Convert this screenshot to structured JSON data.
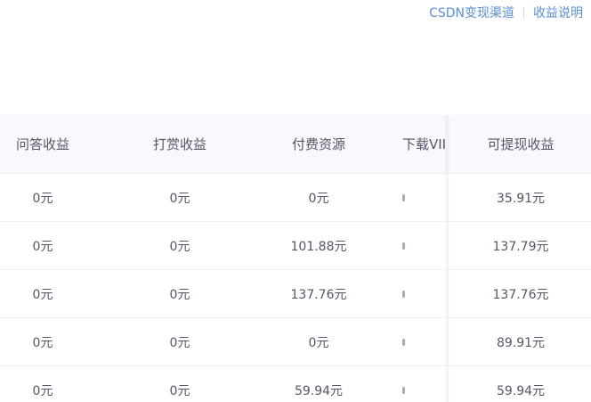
{
  "top_links": {
    "channel": "CSDN变现渠道",
    "explain": "收益说明"
  },
  "table": {
    "headers": [
      "问答收益",
      "打赏收益",
      "付费资源",
      "下载VII",
      "可提现收益"
    ],
    "rows": [
      [
        "0元",
        "0元",
        "0元",
        "35.91元"
      ],
      [
        "0元",
        "0元",
        "101.88元",
        "137.79元"
      ],
      [
        "0元",
        "0元",
        "137.76元",
        "137.76元"
      ],
      [
        "0元",
        "0元",
        "0元",
        "89.91元"
      ],
      [
        "0元",
        "0元",
        "59.94元",
        "59.94元"
      ]
    ]
  }
}
